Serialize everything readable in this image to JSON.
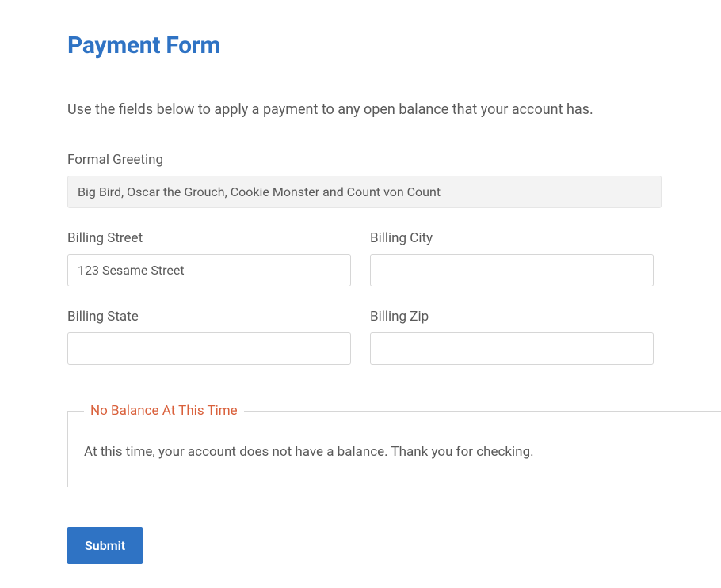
{
  "header": {
    "title": "Payment Form"
  },
  "intro": {
    "description": "Use the fields below to apply a payment to any open balance that your account has."
  },
  "form": {
    "formal_greeting": {
      "label": "Formal Greeting",
      "value": "Big Bird, Oscar the Grouch, Cookie Monster and Count von Count"
    },
    "billing_street": {
      "label": "Billing Street",
      "value": "123 Sesame Street"
    },
    "billing_city": {
      "label": "Billing City",
      "value": ""
    },
    "billing_state": {
      "label": "Billing State",
      "value": ""
    },
    "billing_zip": {
      "label": "Billing Zip",
      "value": ""
    }
  },
  "balance_notice": {
    "legend": "No Balance At This Time",
    "message": "At this time, your account does not have a balance. Thank you for checking."
  },
  "actions": {
    "submit_label": "Submit"
  }
}
